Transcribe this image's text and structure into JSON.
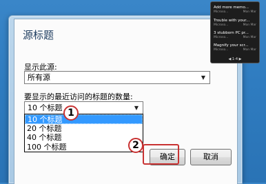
{
  "dialog": {
    "title": "源标题",
    "show_source_label": "显示此源:",
    "source_value": "所有源",
    "count_label": "要显示的最近访问的标题的数量:",
    "count_value": "10 个标题",
    "options": [
      "10 个标题",
      "20 个标题",
      "40 个标题",
      "100 个标题"
    ],
    "selected_option": "10 个标题",
    "ok_label": "确定",
    "cancel_label": "取消"
  },
  "callouts": {
    "one": "1",
    "two": "2"
  },
  "gadget": {
    "items": [
      {
        "title": "Add more memo...",
        "source": "Microso...",
        "time": "Mon Mar"
      },
      {
        "title": "Trouble with your...",
        "source": "Microso...",
        "time": "Mon Mar"
      },
      {
        "title": "3 stubborn PC pr...",
        "source": "Microso...",
        "time": "Mon Mar"
      },
      {
        "title": "Magnify your scr...",
        "source": "Microso...",
        "time": "Mon Mar"
      }
    ],
    "nav": "1-4"
  },
  "colors": {
    "desktop": "#2f7cc0",
    "highlight": "#c83232",
    "selection": "#3399ff"
  }
}
